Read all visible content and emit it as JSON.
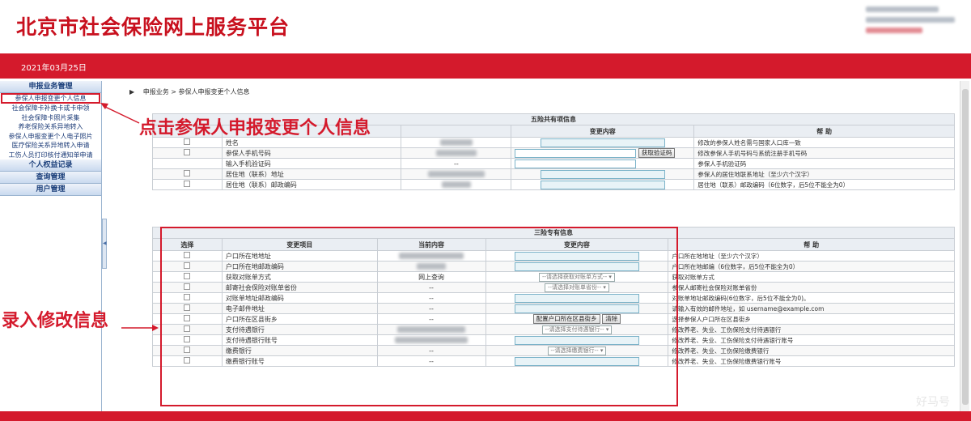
{
  "header": {
    "site_title": "北京市社会保险网上服务平台",
    "date": "2021年03月25日"
  },
  "sidebar": {
    "group1_title": "申报业务管理",
    "items": [
      "参保人申报变更个人信息",
      "社会保障卡补换卡或卡申领",
      "社会保障卡照片采集",
      "养老保险关系异地转入",
      "参保人申报变更个人电子照片",
      "医疗保险关系异地转入申请",
      "工伤人员打印核付通知单申请"
    ],
    "group2_title": "个人权益记录",
    "group3_title": "查询管理",
    "group4_title": "用户管理"
  },
  "breadcrumb": {
    "section": "申报业务",
    "separator": ">",
    "page": "参保人申报变更个人信息"
  },
  "annotations": {
    "click_hint": "点击参保人申报变更个人信息",
    "enter_hint": "录入修改信息"
  },
  "table1": {
    "caption": "五险共有项信息",
    "col_change": "变更内容",
    "col_help": "帮 助",
    "rows": [
      {
        "item": "姓名",
        "current": "",
        "help": "修改的参保人姓名需与国家人口库一致"
      },
      {
        "item": "参保人手机号码",
        "current": "",
        "button": "获取验证码",
        "help": "修改参保人手机号码与系统注册手机号码"
      },
      {
        "item": "输入手机验证码",
        "current": "--",
        "help": "参保人手机验证码"
      },
      {
        "item": "居住地（联系）地址",
        "current": "",
        "help": "参保人的居住地联系地址（至少六个汉字）"
      },
      {
        "item": "居住地（联系）邮政编码",
        "current": "",
        "help": "居住地（联系）邮政编码（6位数字，后5位不能全为0）"
      }
    ]
  },
  "table2": {
    "caption": "三险专有信息",
    "col_select": "选择",
    "col_item": "变更项目",
    "col_current": "当前内容",
    "col_change": "变更内容",
    "col_help": "帮 助",
    "rows": [
      {
        "item": "户口所在地地址",
        "current": "",
        "help": "户口所在地地址（至少六个汉字）"
      },
      {
        "item": "户口所在地邮政编码",
        "current": "",
        "help": "户口所在地邮编（6位数字，后5位不能全为0）"
      },
      {
        "item": "获取对账单方式",
        "current": "网上查询",
        "select": "--请选择获取对账单方式--",
        "help": "获取对账单方式"
      },
      {
        "item": "邮寄社会保险对账单省份",
        "current": "--",
        "select": "--请选择对账单省份--",
        "help": "参保人邮寄社会保险对账单省份"
      },
      {
        "item": "对账单地址邮政编码",
        "current": "--",
        "help": "对账单地址邮政编码(6位数字，后5位不能全为0)。"
      },
      {
        "item": "电子邮件地址",
        "current": "--",
        "help": "请输入有效的邮件地址，如 username@example.com"
      },
      {
        "item": "户口所在区县街乡",
        "current": "--",
        "button": "配置户口所在区县街乡",
        "button2": "清除",
        "help": "选择参保人户口所在区县街乡"
      },
      {
        "item": "支付待遇银行",
        "current": "",
        "select": "--请选择支付待遇银行--",
        "help": "修改养老、失业、工伤保险支付待遇银行"
      },
      {
        "item": "支付待遇银行账号",
        "current": "",
        "help": "修改养老、失业、工伤保险支付待遇银行账号"
      },
      {
        "item": "缴费银行",
        "current": "--",
        "select": "--请选择缴费银行--",
        "help": "修改养老、失业、工伤保险缴费银行"
      },
      {
        "item": "缴费银行账号",
        "current": "--",
        "help": "修改养老、失业、工伤保险缴费银行账号"
      }
    ]
  },
  "watermark": "好马号",
  "colors": {
    "brand_red": "#d41a2c",
    "menu_blue": "#1d3c78"
  }
}
